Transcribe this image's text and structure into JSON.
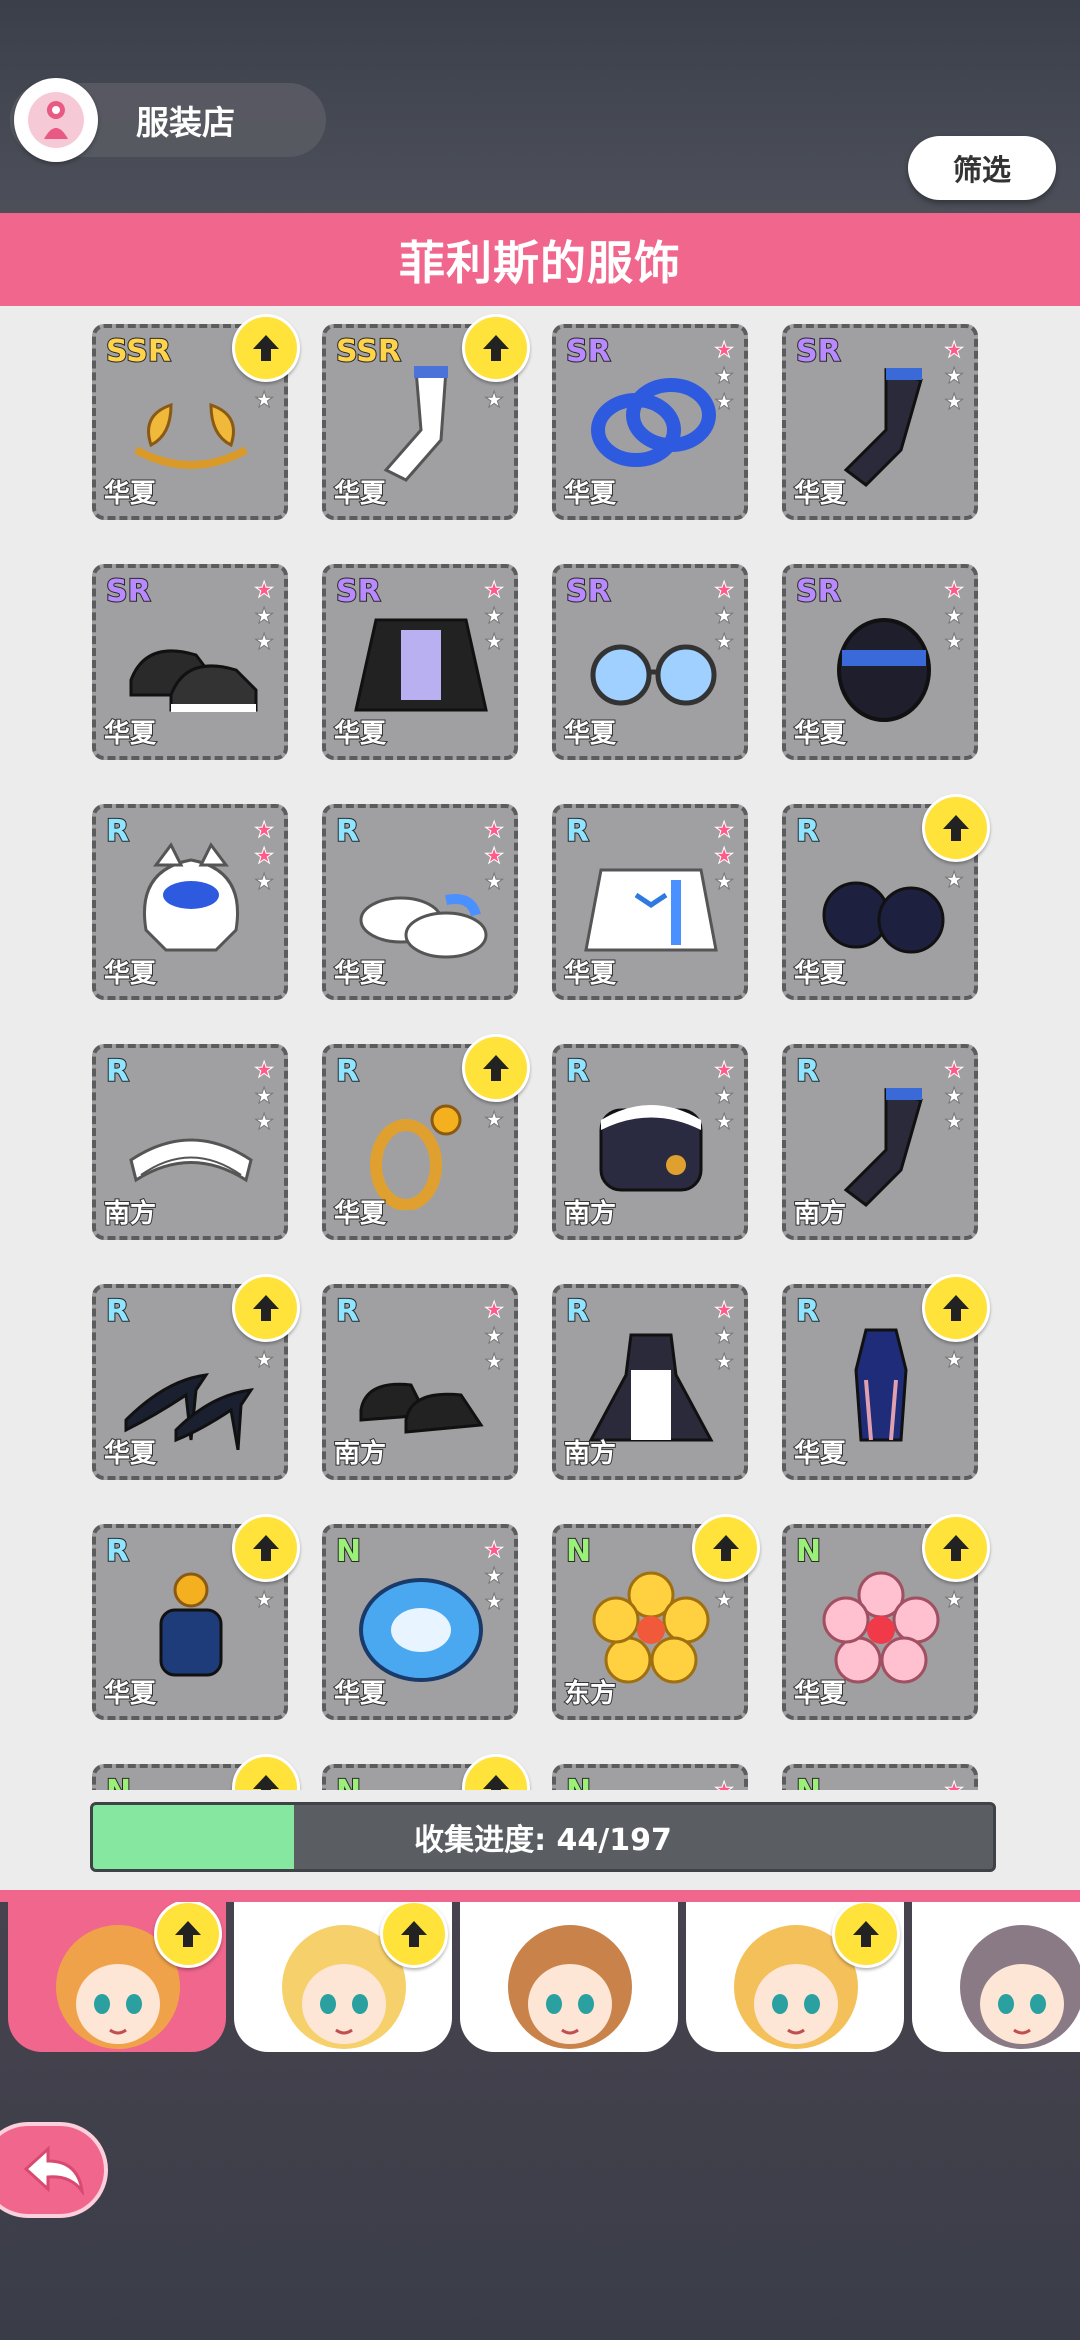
{
  "header": {
    "shop_title": "服装店",
    "filter_label": "筛选"
  },
  "banner": {
    "title": "菲利斯的服饰"
  },
  "items": [
    {
      "rarity": "SSR",
      "region": "华夏",
      "stars": 0,
      "upgrade": true,
      "art": "laurel"
    },
    {
      "rarity": "SSR",
      "region": "华夏",
      "stars": 0,
      "upgrade": true,
      "art": "stockings-white"
    },
    {
      "rarity": "SR",
      "region": "华夏",
      "stars": 1,
      "upgrade": false,
      "art": "rings-blue"
    },
    {
      "rarity": "SR",
      "region": "华夏",
      "stars": 1,
      "upgrade": false,
      "art": "stockings-black"
    },
    {
      "rarity": "SR",
      "region": "华夏",
      "stars": 1,
      "upgrade": false,
      "art": "sneakers"
    },
    {
      "rarity": "SR",
      "region": "华夏",
      "stars": 1,
      "upgrade": false,
      "art": "jacket"
    },
    {
      "rarity": "SR",
      "region": "华夏",
      "stars": 1,
      "upgrade": false,
      "art": "glasses"
    },
    {
      "rarity": "SR",
      "region": "华夏",
      "stars": 1,
      "upgrade": false,
      "art": "bracelet"
    },
    {
      "rarity": "R",
      "region": "华夏",
      "stars": 2,
      "upgrade": false,
      "art": "hood"
    },
    {
      "rarity": "R",
      "region": "华夏",
      "stars": 2,
      "upgrade": false,
      "art": "slippers"
    },
    {
      "rarity": "R",
      "region": "华夏",
      "stars": 2,
      "upgrade": false,
      "art": "hoodie"
    },
    {
      "rarity": "R",
      "region": "华夏",
      "stars": 0,
      "upgrade": true,
      "art": "gloves"
    },
    {
      "rarity": "R",
      "region": "南方",
      "stars": 1,
      "upgrade": false,
      "art": "maid-band"
    },
    {
      "rarity": "R",
      "region": "华夏",
      "stars": 0,
      "upgrade": true,
      "art": "ring-gold"
    },
    {
      "rarity": "R",
      "region": "南方",
      "stars": 1,
      "upgrade": false,
      "art": "cuff"
    },
    {
      "rarity": "R",
      "region": "南方",
      "stars": 1,
      "upgrade": false,
      "art": "stockings-black"
    },
    {
      "rarity": "R",
      "region": "华夏",
      "stars": 0,
      "upgrade": true,
      "art": "heels"
    },
    {
      "rarity": "R",
      "region": "南方",
      "stars": 1,
      "upgrade": false,
      "art": "loafers"
    },
    {
      "rarity": "R",
      "region": "南方",
      "stars": 1,
      "upgrade": false,
      "art": "maid-dress"
    },
    {
      "rarity": "R",
      "region": "华夏",
      "stars": 0,
      "upgrade": true,
      "art": "qipao"
    },
    {
      "rarity": "R",
      "region": "华夏",
      "stars": 0,
      "upgrade": true,
      "art": "perfume"
    },
    {
      "rarity": "N",
      "region": "华夏",
      "stars": 1,
      "upgrade": false,
      "art": "cat-pin"
    },
    {
      "rarity": "N",
      "region": "东方",
      "stars": 0,
      "upgrade": true,
      "art": "flower-yellow"
    },
    {
      "rarity": "N",
      "region": "华夏",
      "stars": 0,
      "upgrade": true,
      "art": "flower-pink"
    },
    {
      "rarity": "N",
      "region": "",
      "stars": 0,
      "upgrade": true,
      "art": "none"
    },
    {
      "rarity": "N",
      "region": "",
      "stars": 0,
      "upgrade": true,
      "art": "none"
    },
    {
      "rarity": "N",
      "region": "",
      "stars": 1,
      "upgrade": false,
      "art": "none"
    },
    {
      "rarity": "N",
      "region": "",
      "stars": 1,
      "upgrade": false,
      "art": "none"
    }
  ],
  "progress": {
    "label": "收集进度: 44/197",
    "collected": 44,
    "total": 197
  },
  "characters": [
    {
      "name": "character-1",
      "upgrade": true,
      "selected": true,
      "hair": "#f0a24a"
    },
    {
      "name": "character-2",
      "upgrade": true,
      "selected": false,
      "hair": "#f6d06a"
    },
    {
      "name": "character-3",
      "upgrade": false,
      "selected": false,
      "hair": "#c9834a"
    },
    {
      "name": "character-4",
      "upgrade": true,
      "selected": false,
      "hair": "#f4c05a"
    },
    {
      "name": "character-5",
      "upgrade": false,
      "selected": false,
      "hair": "#8a7a86"
    }
  ],
  "colors": {
    "accent": "#f0668c",
    "progress_fill": "#86e8a0",
    "upgrade_badge": "#ffe23a"
  }
}
